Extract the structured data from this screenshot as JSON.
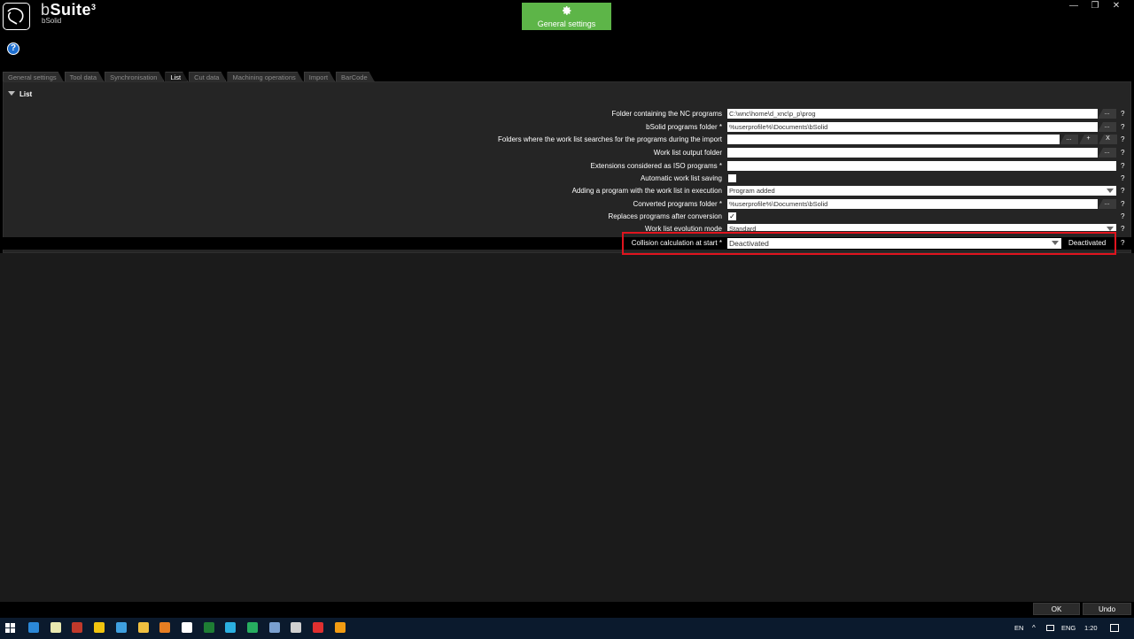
{
  "app": {
    "title_prefix": "b",
    "title_main": "Suite",
    "title_version": "3",
    "subtitle": "bSolid",
    "header_button": "General settings"
  },
  "window_controls": [
    "—",
    "❐",
    "✕"
  ],
  "tabs": [
    "General settings",
    "Tool data",
    "Synchronisation",
    "List",
    "Cut data",
    "Machining operations",
    "Import",
    "BarCode"
  ],
  "active_tab_index": 3,
  "section": {
    "title": "List"
  },
  "rows": [
    {
      "label": "Folder containing the NC programs",
      "value": "C:\\wnc\\home\\d_xnc\\p_p\\prog",
      "button": "..."
    },
    {
      "label": "bSolid programs folder *",
      "value": "%userprofile%\\Documents\\bSolid",
      "button": "..."
    },
    {
      "label": "Folders where the work list searches for the programs during the import",
      "value": "",
      "buttons": [
        "...",
        "+",
        "X"
      ]
    },
    {
      "label": "Work list output folder",
      "value": "",
      "button": "..."
    },
    {
      "label": "Extensions considered as ISO programs *",
      "value": ""
    },
    {
      "label": "Automatic work list saving",
      "checked": false
    },
    {
      "label": "Adding a program with the work list in execution",
      "value": "Program added"
    },
    {
      "label": "Converted programs folder *",
      "value": "%userprofile%\\Documents\\bSolid",
      "button": "..."
    },
    {
      "label": "Replaces programs after conversion",
      "checked": true
    },
    {
      "label": "Work list evolution mode",
      "value": "Standard"
    },
    {
      "label": "Collision calculation at start *",
      "value": "Deactivated",
      "status": "Deactivated"
    }
  ],
  "help_mark": "?",
  "footer": {
    "ok": "OK",
    "undo": "Undo"
  },
  "taskbar": {
    "lang_short": "EN",
    "lang": "ENG",
    "time": "1:20",
    "icon_colors": [
      "#2b88d8",
      "#e8e8b0",
      "#c0392b",
      "#f1c40f",
      "#3fa0e0",
      "#f0c040",
      "#e67e22",
      "#ffffff",
      "#1e7e34",
      "#2bb0e0",
      "#27ae60",
      "#7aa0d0",
      "#d0d0d0",
      "#e03030",
      "#f39c12"
    ]
  }
}
